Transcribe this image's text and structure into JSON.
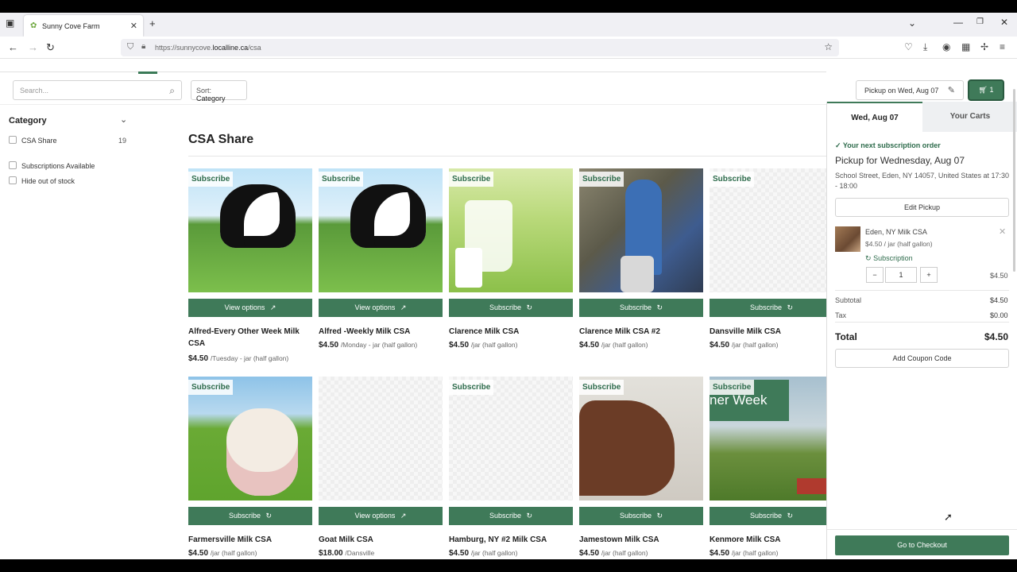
{
  "browser": {
    "tab_title": "Sunny Cove Farm",
    "url_prefix": "https://sunnycove.",
    "url_domain": "localline.ca",
    "url_path": "/csa"
  },
  "toolbar": {
    "search_placeholder": "Search...",
    "sort_label": "Sort:",
    "sort_value": "Category",
    "pickup_label": "Pickup on Wed, Aug 07",
    "cart_count": "1"
  },
  "filters": {
    "title": "Category",
    "items": [
      {
        "label": "CSA Share",
        "count": "19"
      },
      {
        "label": "Subscriptions Available",
        "count": ""
      },
      {
        "label": "Hide out of stock",
        "count": ""
      }
    ]
  },
  "main": {
    "heading": "CSA Share",
    "badge": "Subscribe",
    "products": [
      {
        "title": "Alfred-Every Other Week Milk CSA",
        "price": "$4.50",
        "unit": "/Tuesday - jar (half gallon)",
        "button": "View options"
      },
      {
        "title": "Alfred -Weekly Milk CSA",
        "price": "$4.50",
        "unit": "/Monday - jar (half gallon)",
        "button": "View options"
      },
      {
        "title": "Clarence Milk CSA",
        "price": "$4.50",
        "unit": "/jar (half gallon)",
        "button": "Subscribe"
      },
      {
        "title": "Clarence Milk CSA #2",
        "price": "$4.50",
        "unit": "/jar (half gallon)",
        "button": "Subscribe"
      },
      {
        "title": "Dansville Milk CSA",
        "price": "$4.50",
        "unit": "/jar (half gallon)",
        "button": "Subscribe"
      },
      {
        "title": "Farmersville Milk CSA",
        "price": "$4.50",
        "unit": "/jar (half gallon)",
        "button": "Subscribe"
      },
      {
        "title": "Goat Milk CSA",
        "price": "$18.00",
        "unit": "/Dansville",
        "button": "View options"
      },
      {
        "title": "Hamburg, NY #2 Milk CSA",
        "price": "$4.50",
        "unit": "/jar (half gallon)",
        "button": "Subscribe"
      },
      {
        "title": "Jamestown Milk CSA",
        "price": "$4.50",
        "unit": "/jar (half gallon)",
        "button": "Subscribe"
      },
      {
        "title": "Kenmore Milk CSA",
        "price": "$4.50",
        "unit": "/jar (half gallon)",
        "button": "Subscribe"
      }
    ],
    "image_overlay_text": "ner Week"
  },
  "cart": {
    "tab_active": "Wed, Aug 07",
    "tab_other": "Your Carts",
    "next_order": "Your next subscription order",
    "pickup_heading": "Pickup for Wednesday, Aug 07",
    "address": "School Street, Eden, NY 14057, United States at 17:30 - 18:00",
    "edit_pickup": "Edit Pickup",
    "item_name": "Eden, NY Milk CSA",
    "item_unit": "$4.50 / jar (half gallon)",
    "item_sub": "Subscription",
    "item_qty": "1",
    "item_total": "$4.50",
    "subtotal_label": "Subtotal",
    "subtotal": "$4.50",
    "tax_label": "Tax",
    "tax": "$0.00",
    "total_label": "Total",
    "total": "$4.50",
    "coupon": "Add Coupon Code",
    "checkout": "Go to Checkout"
  },
  "colors": {
    "accent": "#3f7a59",
    "badge_text": "#2d6b4b"
  }
}
